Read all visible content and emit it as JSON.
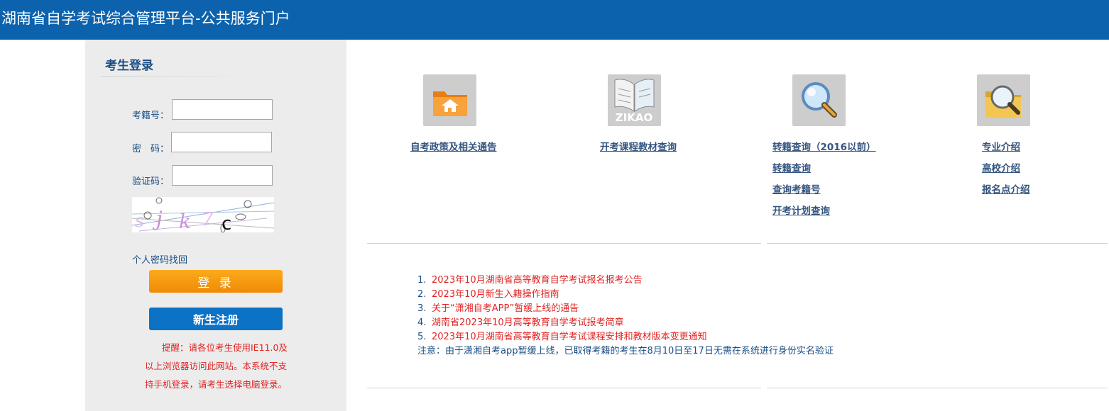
{
  "header": {
    "title": "湖南省自学考试综合管理平台-公共服务门户"
  },
  "login": {
    "title": "考生登录",
    "id_label": "考籍号：",
    "password_label": "密　码：",
    "captcha_label": "验证码：",
    "captcha_text": "sjk7c",
    "forgot": "个人密码找回",
    "login_button": "登 录",
    "register_button": "新生注册",
    "notice": "提醒：请各位考生使用IE11.0及以上浏览器访问此网站。本系统不支持手机登录，请考生选择电脑登录。"
  },
  "tiles": [
    {
      "icon": "folder-home-icon",
      "links": [
        "自考政策及相关通告"
      ]
    },
    {
      "icon": "zikao-book-icon",
      "icon_text": "ZIKAO",
      "links": [
        "开考课程教材查询"
      ]
    },
    {
      "icon": "magnifier-icon",
      "links": [
        "转籍查询（2016以前）",
        "转籍查询",
        "查询考籍号",
        "开考计划查询"
      ]
    },
    {
      "icon": "folder-search-icon",
      "links": [
        "专业介绍",
        "高校介绍",
        "报名点介绍"
      ]
    }
  ],
  "news": {
    "items": [
      {
        "num": "1.",
        "text": "2023年10月湖南省高等教育自学考试报名报考公告"
      },
      {
        "num": "2.",
        "text": "2023年10月新生入籍操作指南"
      },
      {
        "num": "3.",
        "text": "关于“潇湘自考APP”暂缓上线的通告"
      },
      {
        "num": "4.",
        "text": "湖南省2023年10月高等教育自学考试报考简章"
      },
      {
        "num": "5.",
        "text": "2023年10月湖南省高等教育自学考试课程安排和教材版本变更通知"
      }
    ],
    "note": "注意：由于潇湘自考app暂缓上线，已取得考籍的考生在8月10日至17日无需在系统进行身份实名验证"
  },
  "colors": {
    "header": "#0c62ad",
    "login_btn": "#f49a0f",
    "register_btn": "#0c72c6",
    "alert": "#e02424",
    "link": "#35557f"
  }
}
